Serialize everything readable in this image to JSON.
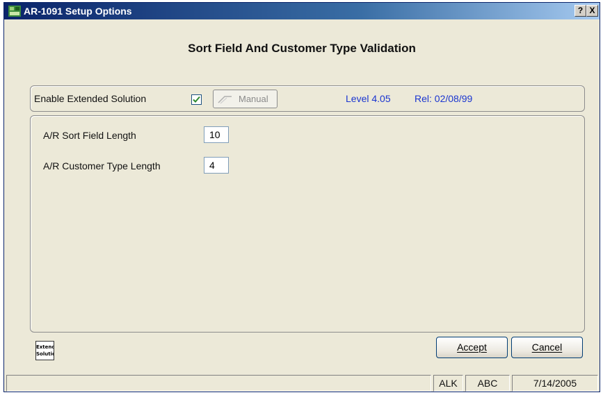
{
  "window": {
    "title": "AR-1091 Setup Options"
  },
  "title_buttons": {
    "help": "?",
    "close": "X"
  },
  "form_title": "Sort Field And Customer Type Validation",
  "options_group": {
    "enable_label": "Enable Extended Solution",
    "enable_checked": true,
    "manual_button": "Manual",
    "level": "Level 4.05",
    "release": "Rel: 02/08/99"
  },
  "fields": [
    {
      "label": "A/R Sort Field Length",
      "value": "10"
    },
    {
      "label": "A/R Customer Type Length",
      "value": "4"
    }
  ],
  "logo": {
    "line1": "Extended",
    "line2": "Solutions"
  },
  "buttons": {
    "accept": "Accept",
    "cancel": "Cancel"
  },
  "status_bar": {
    "panes": [
      "ALK",
      "ABC",
      "7/14/2005"
    ]
  },
  "colors": {
    "title_bar": "#0a246a",
    "info_text": "#1a35d0",
    "checkbox_check": "#2f8a2f"
  }
}
